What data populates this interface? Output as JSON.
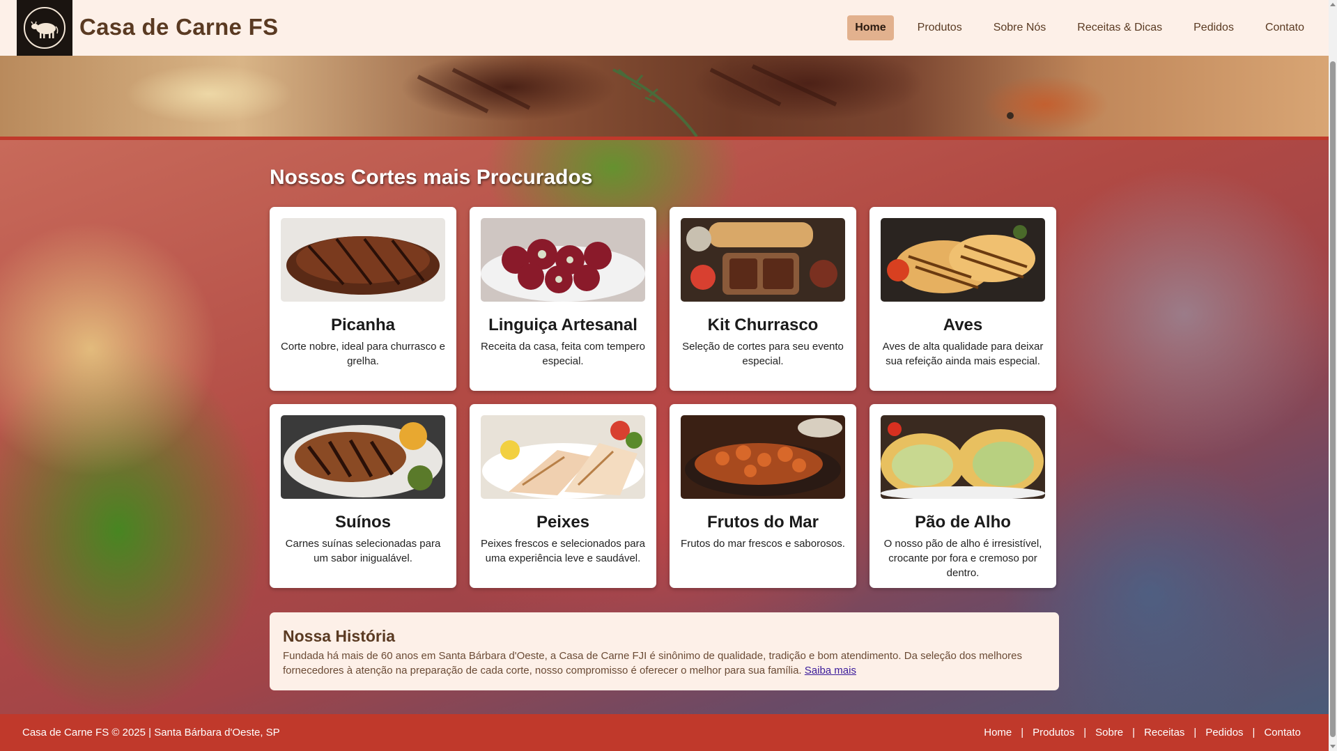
{
  "header": {
    "logo_icon": "cow-icon",
    "title": "Casa de Carne FS",
    "nav": [
      {
        "label": "Home",
        "active": true
      },
      {
        "label": "Produtos",
        "active": false
      },
      {
        "label": "Sobre Nós",
        "active": false
      },
      {
        "label": "Receitas & Dicas",
        "active": false
      },
      {
        "label": "Pedidos",
        "active": false
      },
      {
        "label": "Contato",
        "active": false
      }
    ]
  },
  "main": {
    "section_title": "Nossos Cortes mais Procurados",
    "products": [
      {
        "title": "Picanha",
        "desc": "Corte nobre, ideal para churrasco e grelha.",
        "image": "picanha-photo"
      },
      {
        "title": "Linguiça Artesanal",
        "desc": "Receita da casa, feita com tempero especial.",
        "image": "linguica-photo"
      },
      {
        "title": "Kit Churrasco",
        "desc": "Seleção de cortes para seu evento especial.",
        "image": "kit-churrasco-photo"
      },
      {
        "title": "Aves",
        "desc": "Aves de alta qualidade para deixar sua refeição ainda mais especial.",
        "image": "aves-photo"
      },
      {
        "title": "Suínos",
        "desc": "Carnes suínas selecionadas para um sabor inigualável.",
        "image": "suinos-photo"
      },
      {
        "title": "Peixes",
        "desc": "Peixes frescos e selecionados para uma experiência leve e saudável.",
        "image": "peixes-photo"
      },
      {
        "title": "Frutos do Mar",
        "desc": "Frutos do mar frescos e saborosos.",
        "image": "frutos-do-mar-photo"
      },
      {
        "title": "Pão de Alho",
        "desc": "O nosso pão de alho é irresistível, crocante por fora e cremoso por dentro.",
        "image": "pao-de-alho-photo"
      }
    ],
    "history": {
      "title": "Nossa História",
      "text": "Fundada há mais de 60 anos em Santa Bárbara d'Oeste, a Casa de Carne FJI é sinônimo de qualidade, tradição e bom atendimento. Da seleção dos melhores fornecedores à atenção na preparação de cada corte, nosso compromisso é oferecer o melhor para sua família.",
      "link": "Saiba mais"
    }
  },
  "footer": {
    "copyright": "Casa de Carne FS © 2025 | Santa Bárbara d'Oeste, SP",
    "links": [
      "Home",
      "Produtos",
      "Sobre",
      "Receitas",
      "Pedidos",
      "Contato"
    ],
    "separator": "|"
  },
  "colors": {
    "header_bg": "#fdf0e8",
    "brand_brown": "#5a3a22",
    "nav_active_bg": "#e2b18e",
    "accent_red": "#c0392b",
    "card_bg": "#ffffff"
  }
}
